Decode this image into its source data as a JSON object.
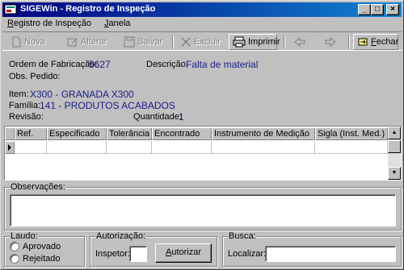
{
  "window": {
    "title": "SIGEWin - Registro de Inspeção",
    "controls": [
      "_",
      "□",
      "×"
    ]
  },
  "menu": [
    {
      "label": "Registro de Inspeção",
      "accel": "R"
    },
    {
      "label": "Janela",
      "accel": "J"
    }
  ],
  "toolbar": [
    {
      "label": "Nova",
      "icon": "new-document-icon",
      "enabled": false
    },
    {
      "label": "Alterar",
      "icon": "edit-icon",
      "enabled": false
    },
    {
      "label": "Salvar",
      "icon": "save-icon",
      "enabled": false
    },
    {
      "label": "Excluir",
      "icon": "delete-icon",
      "enabled": false
    },
    {
      "label": "Imprimir",
      "icon": "printer-icon",
      "enabled": true
    },
    {
      "label": "",
      "icon": "arrow-left-icon",
      "enabled": false
    },
    {
      "label": "",
      "icon": "arrow-right-icon",
      "enabled": false
    },
    {
      "label": "Fechar",
      "icon": "close-door-icon",
      "enabled": true
    }
  ],
  "info": {
    "ordem_label": "Ordem de Fabricação:",
    "ordem_value": "5627",
    "descricao_label": "Descrição:",
    "descricao_value": "Falta de material",
    "obs_pedido_label": "Obs. Pedido:",
    "item_label": "Item:",
    "item_value": "X300 - GRANADA X300",
    "familia_label": "Família:",
    "familia_value": "141 - PRODUTOS ACABADOS",
    "revisao_label": "Revisão:",
    "quantidade_label": "Quantidade:",
    "quantidade_value": "1"
  },
  "grid": {
    "columns": [
      "Ref.",
      "Especificado",
      "Tolerância",
      "Encontrado",
      "Instrumento de Medição",
      "Sigla (Inst. Med.)"
    ],
    "rows": [
      [
        "",
        "",
        "",
        "",
        "",
        ""
      ]
    ]
  },
  "observacoes": {
    "label": "Observações:",
    "value": ""
  },
  "laudo": {
    "label": "Laudo:",
    "options": [
      "Aprovado",
      "Rejeitado"
    ]
  },
  "autorizacao": {
    "label": "Autorização:",
    "inspetor_label": "Inspetor:",
    "inspetor_value": "",
    "button": "Autorizar"
  },
  "busca": {
    "label": "Busca:",
    "localizar_label": "Localizar:",
    "localizar_value": ""
  },
  "colors": {
    "title_start": "#000080",
    "title_end": "#1084d0",
    "value_text": "#1a1a8c",
    "face": "#c0c0c0"
  }
}
